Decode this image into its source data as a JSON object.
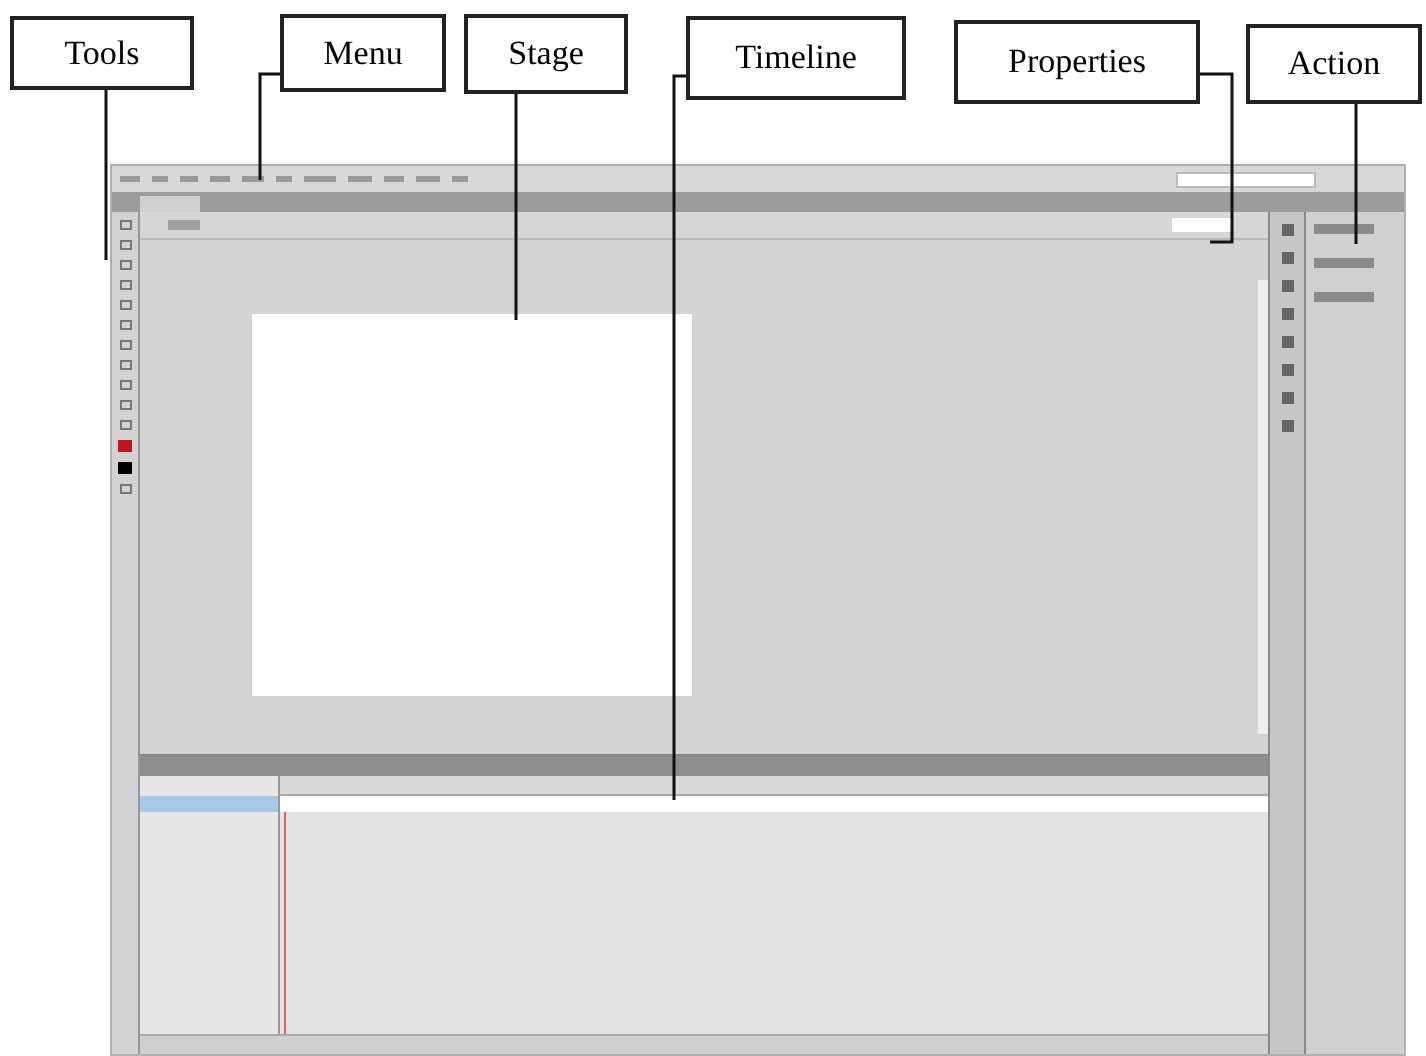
{
  "callouts": [
    {
      "label": "Tools"
    },
    {
      "label": "Menu"
    },
    {
      "label": "Stage"
    },
    {
      "label": "Timeline"
    },
    {
      "label": "Properties"
    },
    {
      "label": "Action"
    }
  ]
}
